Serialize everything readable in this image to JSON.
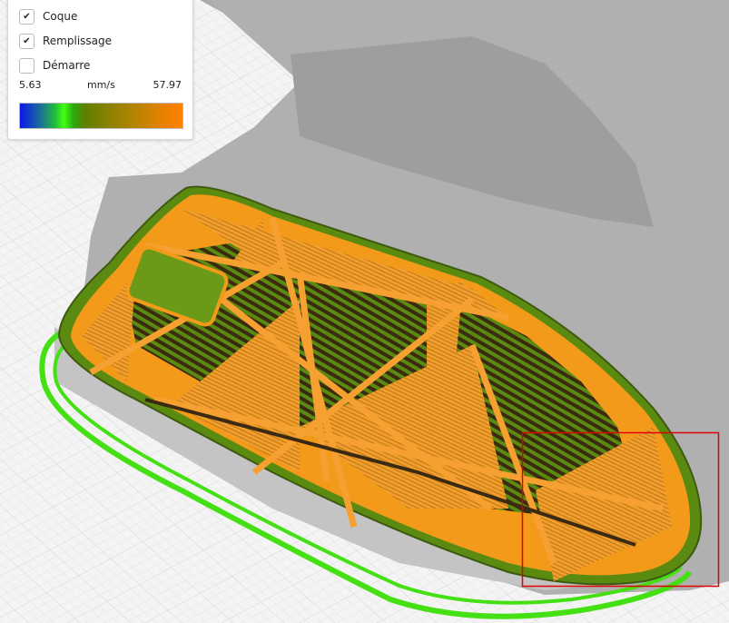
{
  "legend": {
    "items": [
      {
        "label": "Coque",
        "checked": true
      },
      {
        "label": "Remplissage",
        "checked": true
      },
      {
        "label": "Démarre",
        "checked": false
      }
    ],
    "min": "5.63",
    "unit": "mm/s",
    "max": "57.97",
    "check_glyph": "✔"
  },
  "colors": {
    "slow": "#0a18e6",
    "mid": "#44ff10",
    "fast": "#ff8200",
    "selection": "#e00000"
  }
}
